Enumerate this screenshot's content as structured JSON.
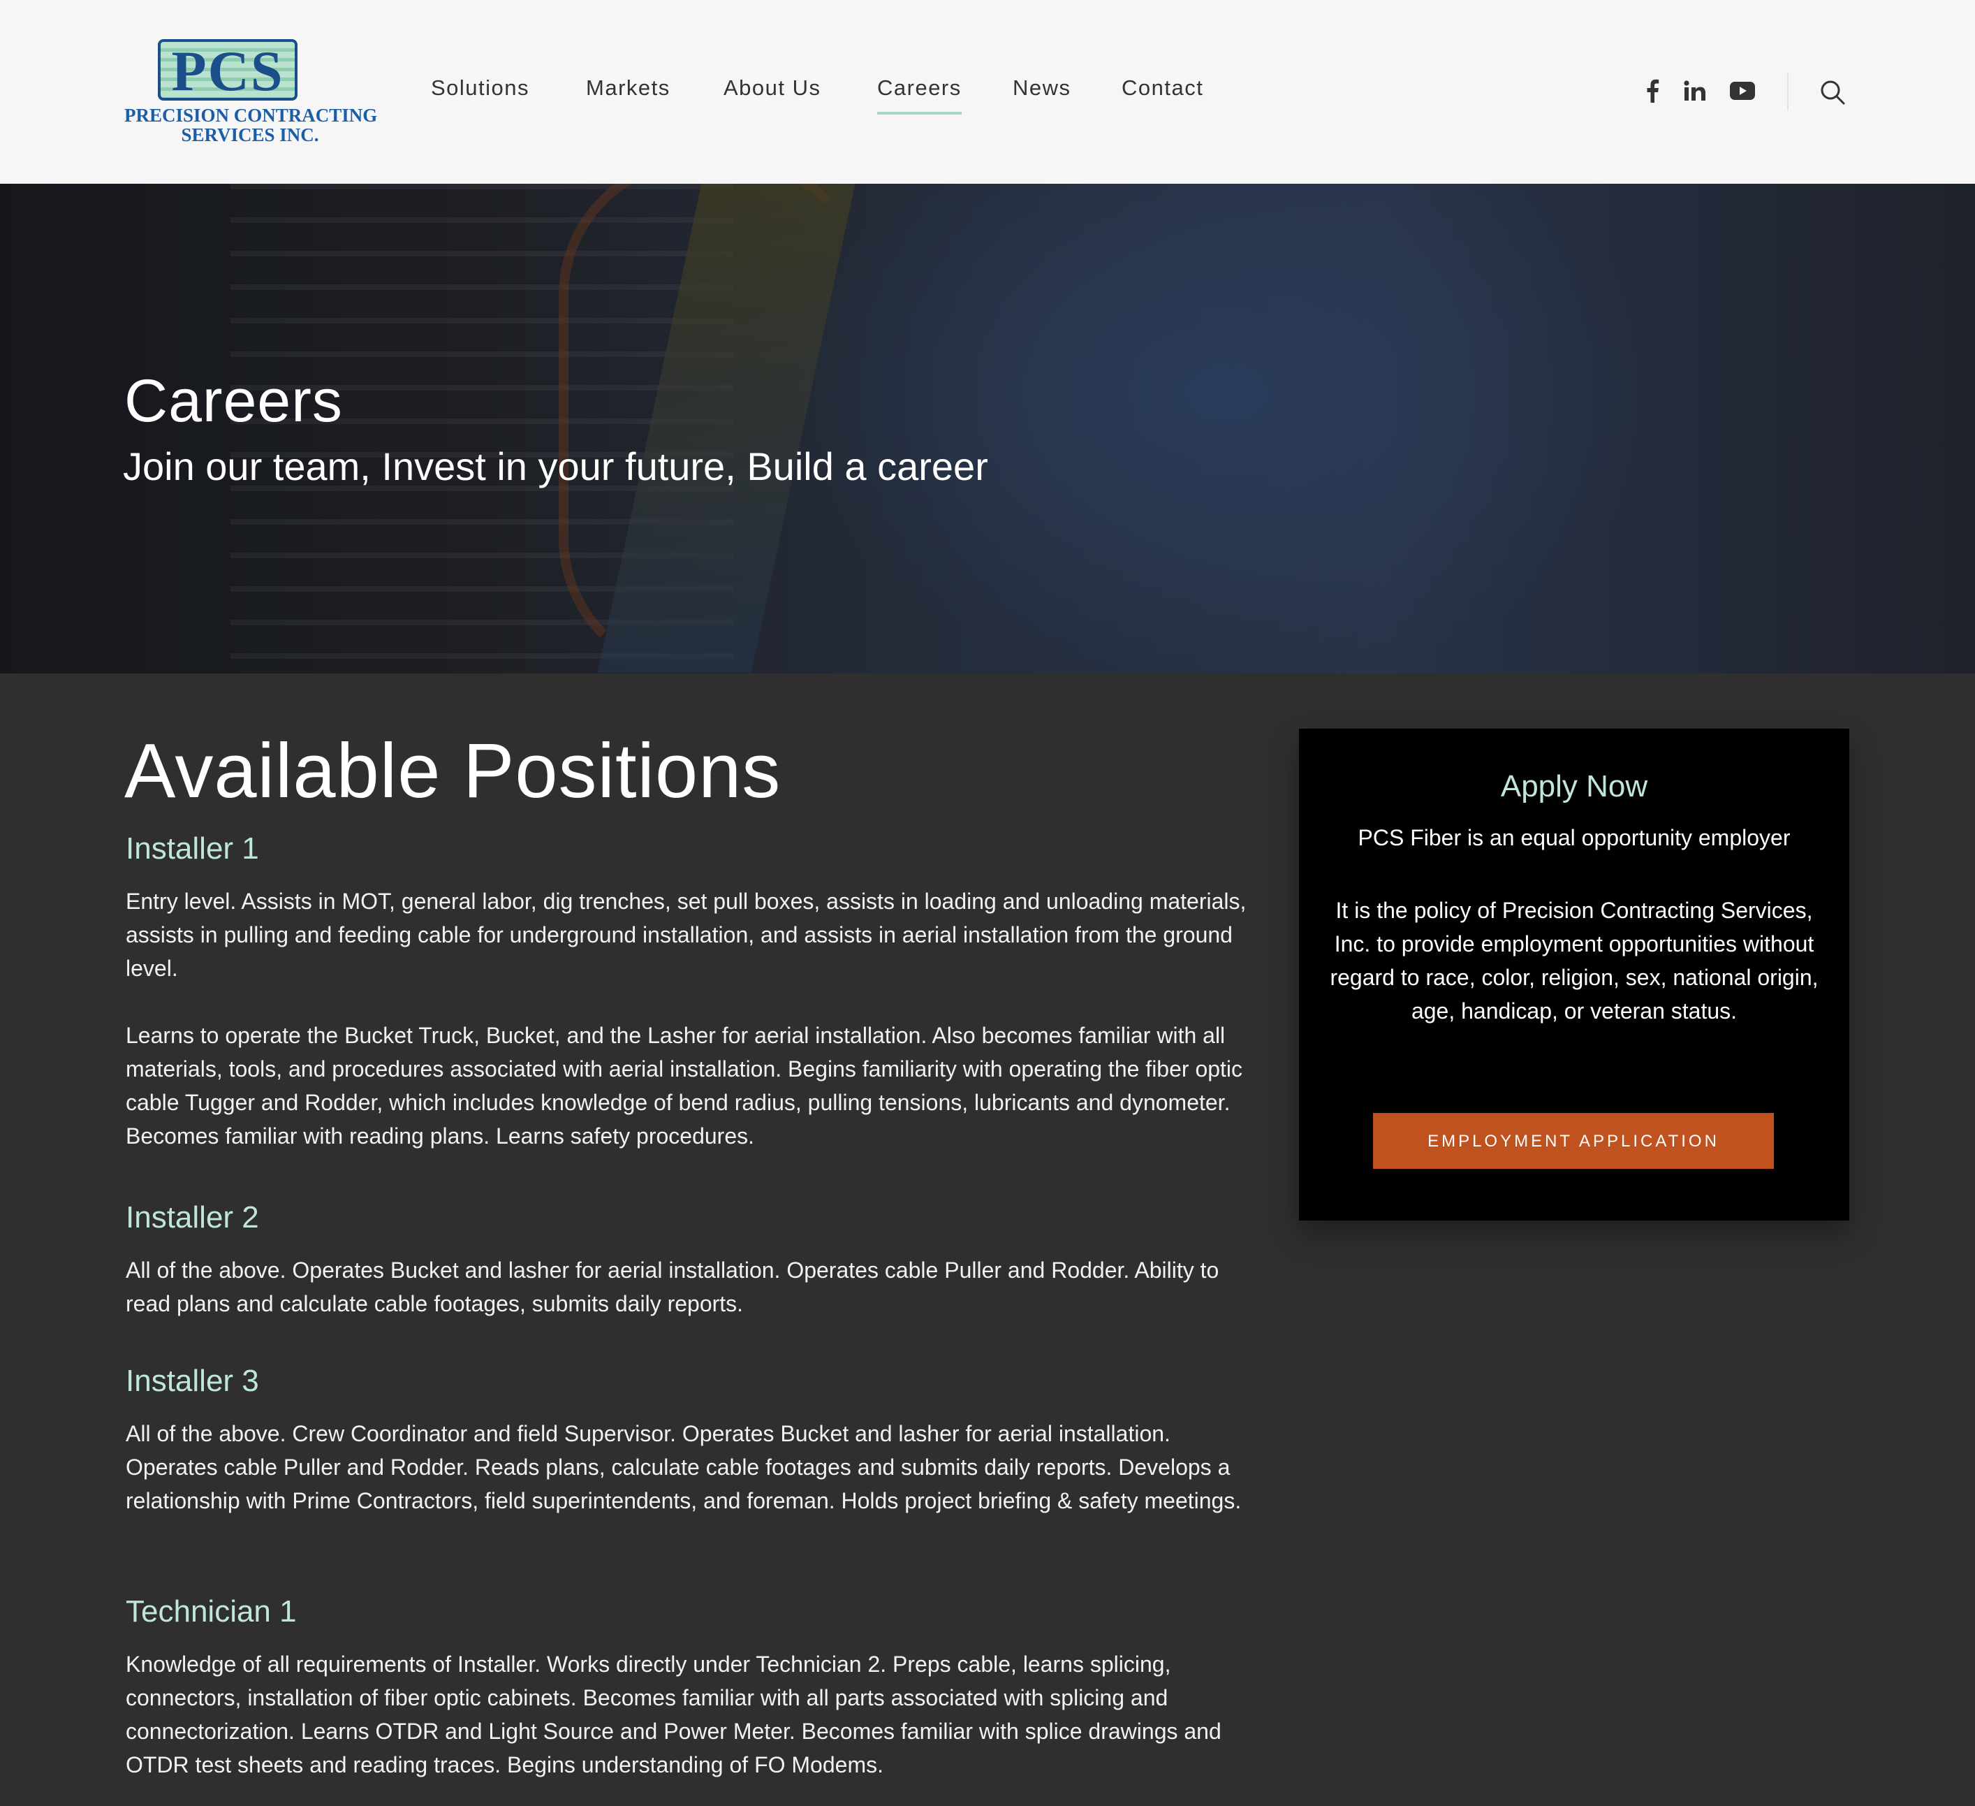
{
  "header": {
    "logo": {
      "mark": "PCS",
      "line1": "PRECISION CONTRACTING",
      "line2": "SERVICES INC."
    },
    "nav": [
      {
        "label": "Solutions"
      },
      {
        "label": "Markets"
      },
      {
        "label": "About Us"
      },
      {
        "label": "Careers",
        "active": true
      },
      {
        "label": "News"
      },
      {
        "label": "Contact"
      }
    ],
    "social_icons": [
      "facebook-icon",
      "linkedin-icon",
      "youtube-icon"
    ],
    "search_icon": "search-icon"
  },
  "hero": {
    "title": "Careers",
    "subtitle": "Join our team, Invest in your future, Build a career"
  },
  "main": {
    "title": "Available Positions",
    "positions": [
      {
        "title": "Installer 1",
        "paragraphs": [
          "Entry level. Assists in MOT, general labor, dig trenches, set pull boxes, assists in loading and unloading materials, assists in pulling and feeding cable for underground installation, and assists in aerial installation from the ground level.",
          "Learns to operate the Bucket Truck, Bucket, and the Lasher for aerial installation. Also becomes familiar with all materials, tools, and procedures associated with aerial installation. Begins familiarity with operating the fiber optic cable Tugger and Rodder, which includes knowledge of bend radius, pulling tensions, lubricants and dynometer. Becomes familiar with reading plans. Learns safety procedures."
        ]
      },
      {
        "title": "Installer 2",
        "paragraphs": [
          "All of the above. Operates Bucket and lasher for aerial installation. Operates cable Puller and Rodder. Ability to read plans and calculate cable footages, submits daily reports."
        ]
      },
      {
        "title": "Installer 3",
        "paragraphs": [
          "All of the above. Crew Coordinator and field Supervisor. Operates Bucket and lasher for aerial installation. Operates cable Puller and Rodder. Reads plans, calculate cable footages and submits daily reports. Develops a relationship with Prime Contractors, field superintendents, and foreman. Holds project briefing & safety meetings."
        ]
      },
      {
        "title": "Technician 1",
        "paragraphs": [
          "Knowledge of all requirements of Installer. Works directly under Technician 2. Preps cable, learns splicing, connectors, installation of fiber optic cabinets. Becomes familiar with all parts associated with splicing and connectorization. Learns OTDR and Light Source and Power Meter. Becomes familiar with splice drawings and OTDR test sheets and reading traces. Begins understanding of FO Modems."
        ]
      }
    ]
  },
  "apply": {
    "title": "Apply Now",
    "subtitle": "PCS Fiber is an equal opportunity employer",
    "policy": "It is the policy of Precision Contracting Services, Inc. to provide employment opportunities without regard to race, color, religion, sex, national origin, age, handicap, or veteran status.",
    "button_label": "EMPLOYMENT APPLICATION"
  },
  "colors": {
    "header_bg": "#f6f6f6",
    "page_bg": "#2f2f2f",
    "accent_heading": "#bfe6d6",
    "button": "#c0521f",
    "logo_blue": "#1b4f8a"
  }
}
